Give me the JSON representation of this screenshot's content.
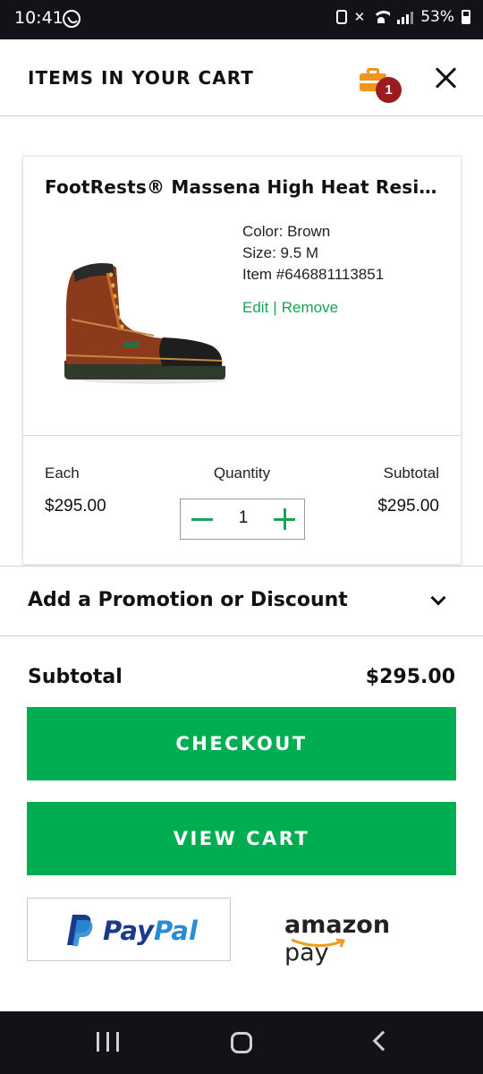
{
  "status_bar": {
    "time": "10:41",
    "battery": "53%"
  },
  "header": {
    "title": "ITEMS IN YOUR CART",
    "cart_count": "1"
  },
  "cart": {
    "items": [
      {
        "name": "FootRests® Massena High Heat Resistant",
        "color": "Color: Brown",
        "size": "Size: 9.5 M",
        "item_number": "Item #646881113851",
        "edit_label": "Edit",
        "separator": "|",
        "remove_label": "Remove",
        "each_label": "Each",
        "each_value": "$295.00",
        "quantity_label": "Quantity",
        "quantity": "1",
        "subtotal_label": "Subtotal",
        "subtotal_value": "$295.00"
      }
    ]
  },
  "promo": {
    "label": "Add a Promotion or Discount"
  },
  "summary": {
    "subtotal_label": "Subtotal",
    "subtotal_value": "$295.00"
  },
  "buttons": {
    "checkout": "CHECKOUT",
    "view_cart": "VIEW CART"
  },
  "payments": {
    "paypal_pay": "Pay",
    "paypal_pal": "Pal",
    "amazon_bold": "amazon",
    "amazon_light": " pay"
  },
  "colors": {
    "accent_green": "#00ad50",
    "link_green": "#1aa352",
    "badge_red": "#9b1b1e",
    "cart_orange": "#f0961e"
  }
}
